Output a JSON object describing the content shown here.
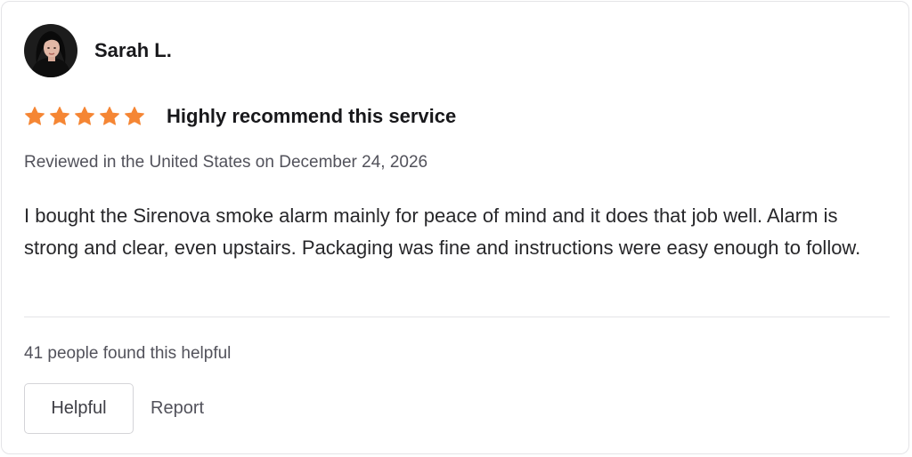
{
  "reviewer": {
    "name": "Sarah L."
  },
  "review": {
    "rating": 5,
    "rating_max": 5,
    "star_color": "#f58634",
    "title": "Highly recommend this service",
    "meta": "Reviewed in the United States on December 24, 2026",
    "body": "I bought the Sirenova smoke alarm mainly for peace of mind and it does that job well. Alarm is strong and clear, even upstairs. Packaging was fine and instructions were easy enough to follow."
  },
  "feedback": {
    "helpful_count_text": "41 people found this helpful",
    "helpful_label": "Helpful",
    "report_label": "Report"
  }
}
